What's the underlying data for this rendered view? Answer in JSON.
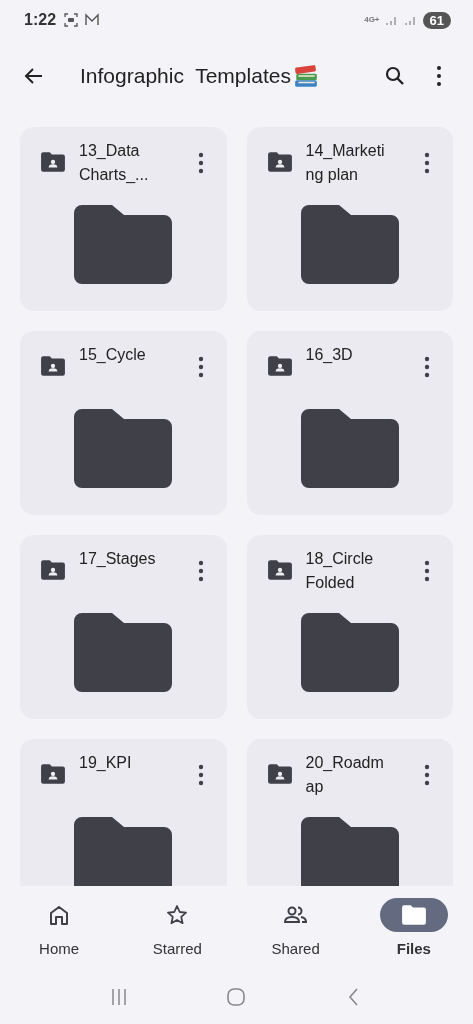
{
  "status_bar": {
    "time": "1:22",
    "network": "4G+",
    "battery": "61"
  },
  "app_bar": {
    "title": "Infographic  Templates"
  },
  "folders": [
    {
      "name": "13_Data\nCharts_..."
    },
    {
      "name": "14_Marketi\nng plan"
    },
    {
      "name": "15_Cycle"
    },
    {
      "name": "16_3D"
    },
    {
      "name": "17_Stages"
    },
    {
      "name": "18_Circle\nFolded"
    },
    {
      "name": "19_KPI"
    },
    {
      "name": "20_Roadm\nap"
    }
  ],
  "bottom_nav": [
    {
      "label": "Home",
      "kind": "home",
      "selected": false
    },
    {
      "label": "Starred",
      "kind": "star",
      "selected": false
    },
    {
      "label": "Shared",
      "kind": "shared",
      "selected": false
    },
    {
      "label": "Files",
      "kind": "files",
      "selected": true
    }
  ]
}
